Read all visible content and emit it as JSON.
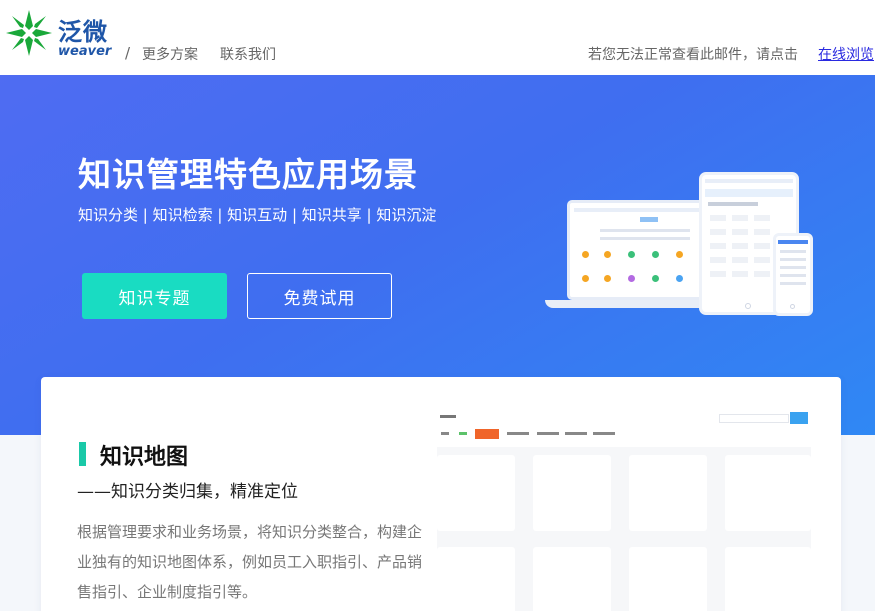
{
  "header": {
    "logo_cn": "泛微",
    "logo_en": "weaver",
    "separator": "/",
    "nav": {
      "more": "更多方案",
      "contact": "联系我们"
    },
    "notice_text": "若您无法正常查看此邮件，请点击",
    "notice_link": "在线浏览"
  },
  "banner": {
    "title": "知识管理特色应用场景",
    "subtitle": "知识分类 | 知识检索 | 知识互动 | 知识共享 | 知识沉淀",
    "btn_topic": "知识专题",
    "btn_trial": "免费试用"
  },
  "section": {
    "title": "知识地图",
    "subtitle": "——知识分类归集，精准定位",
    "description": "根据管理要求和业务场景，将知识分类整合，构建企业独有的知识地图体系，例如员工入职指引、产品销售指引、企业制度指引等。"
  },
  "colors": {
    "brand_blue": "#1f56a8",
    "banner_blue": "#4068f2",
    "accent_teal": "#19dcc2",
    "link": "#2a2ae0"
  },
  "icons": {
    "logo": "weaver-logo-icon"
  }
}
